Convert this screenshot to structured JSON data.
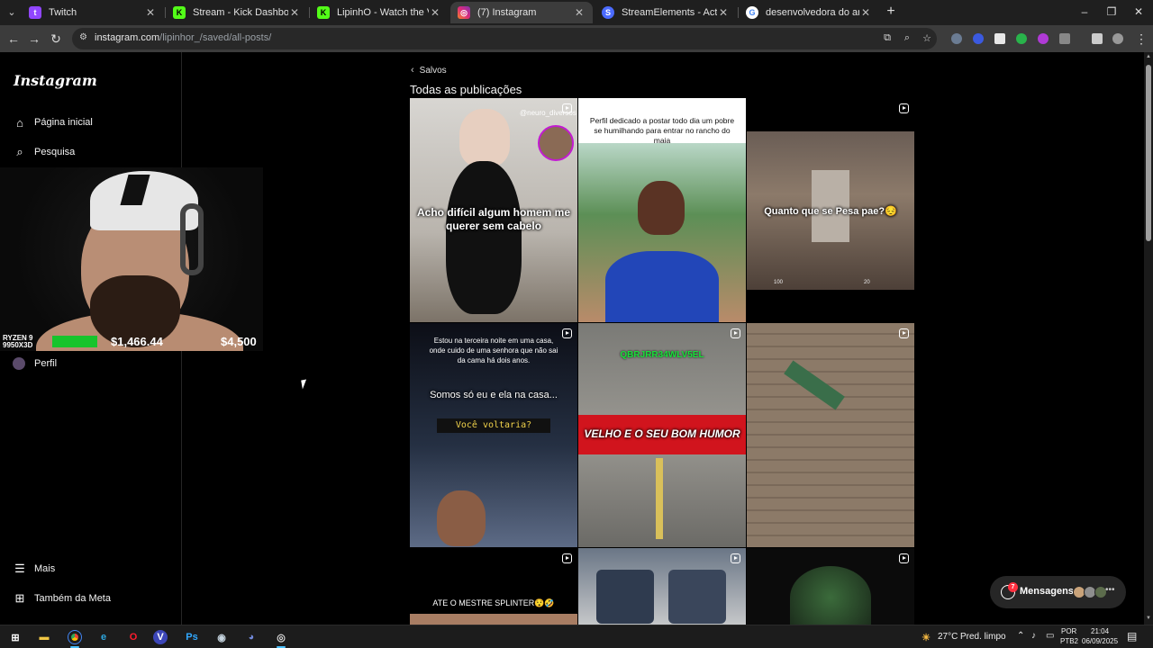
{
  "browser": {
    "tabs": [
      {
        "title": "Twitch",
        "icon": "twitch-icon",
        "color": "#9146ff"
      },
      {
        "title": "Stream - Kick Dashboard",
        "icon": "kick-icon",
        "color": "#53fc18"
      },
      {
        "title": "LipinhO - Watch the VOD on Ki",
        "icon": "kick-icon",
        "color": "#53fc18"
      },
      {
        "title": "(7) Instagram",
        "icon": "instagram-icon",
        "color": "#e1306c"
      },
      {
        "title": "StreamElements - Activity feed",
        "icon": "streamelements-icon",
        "color": "#4b6bff"
      },
      {
        "title": "desenvolvedora do ark - Pesqu",
        "icon": "google-icon",
        "color": "#4285f4"
      }
    ],
    "url_host": "instagram.com",
    "url_path": "/lipinhor_/saved/all-posts/"
  },
  "instagram": {
    "logo": "Instagram",
    "nav": {
      "home": "Página inicial",
      "search": "Pesquisa",
      "profile": "Perfil",
      "more": "Mais",
      "meta": "Também da Meta"
    },
    "back_label": "Salvos",
    "section_title": "Todas as publicações",
    "posts": [
      {
        "caption": "Acho difícil algum homem me querer sem cabelo",
        "watermark": "@neuro_diversos"
      },
      {
        "caption": "Perfil dedicado a postar todo dia um pobre se humilhando para entrar no rancho do maia"
      },
      {
        "caption": "Quanto que se Pesa pae?😔",
        "hud_left": "100",
        "hud_right": "20"
      },
      {
        "caption_top": "Estou na terceira noite em uma casa, onde cuido de uma senhora que não sai da cama há dois anos.",
        "caption_mid": "Somos só eu e ela na casa...",
        "caption_q": "Você voltaria?"
      },
      {
        "code": "QBRJRR34WLV5EL",
        "caption": "VELHO E O SEU BOM HUMOR"
      },
      {
        "caption": ""
      },
      {
        "caption": "ATE O MESTRE SPLINTER😯🤣"
      },
      {
        "caption": ""
      },
      {
        "caption": ""
      }
    ],
    "messages": {
      "label": "Mensagens",
      "badge": "7"
    }
  },
  "stream_overlay": {
    "cpu_label": "RYZEN 9 9950X3D",
    "amount_left": "$1,466.44",
    "amount_right": "$4,500"
  },
  "taskbar": {
    "weather": "27°C",
    "weather_desc": "Pred. limpo",
    "lang_line1": "POR",
    "lang_line2": "PTB2",
    "time": "21:04",
    "date": "06/09/2025"
  }
}
